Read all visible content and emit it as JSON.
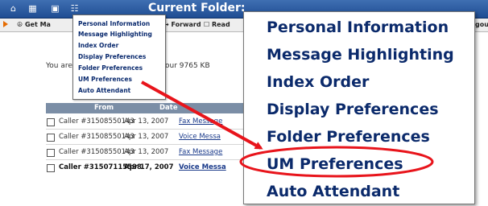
{
  "window": {
    "title": "Current Folder:"
  },
  "top_icons": [
    "home-icon",
    "grid-icon",
    "window-icon",
    "settings-icon"
  ],
  "toolbar": {
    "get_mail": "Get Ma",
    "forward": "Forward",
    "read": "Read",
    "logout": "gout"
  },
  "quota": {
    "prefix": "You are",
    "suffix": "our 9765 KB"
  },
  "table": {
    "columns": [
      "From",
      "Date"
    ],
    "rows": [
      {
        "from": "Caller #31508550143",
        "date": "Apr 13, 2007",
        "type": "Fax Message",
        "unread": false
      },
      {
        "from": "Caller #31508550143",
        "date": "Apr 13, 2007",
        "type": "Voice Messa",
        "unread": false
      },
      {
        "from": "Caller #31508550143",
        "date": "Apr 13, 2007",
        "type": "Fax Message",
        "unread": false
      },
      {
        "from": "Caller #31507115598",
        "date": "Apr 17, 2007",
        "type": "Voice Messa",
        "unread": true
      }
    ]
  },
  "settings_menu": {
    "items": [
      "Personal Information",
      "Message Highlighting",
      "Index Order",
      "Display Preferences",
      "Folder Preferences",
      "UM Preferences",
      "Auto Attendant"
    ],
    "highlighted_index": 5
  },
  "colors": {
    "annotation": "#e8141b",
    "menu_text": "#0b2a6b",
    "header_bar": "#2a5aa0"
  }
}
